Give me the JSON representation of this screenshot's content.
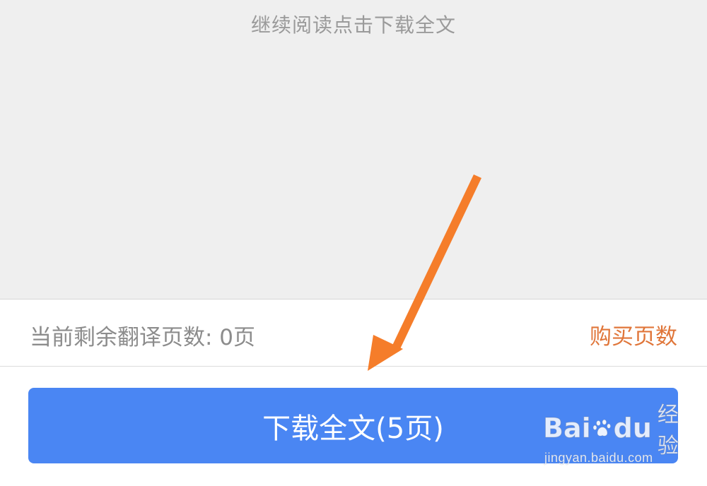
{
  "preview": {
    "continue_hint": "继续阅读点击下载全文"
  },
  "quota": {
    "remaining_label": "当前剩余翻译页数: 0页",
    "buy_link": "购买页数"
  },
  "download": {
    "button_label": "下载全文(5页)"
  },
  "annotation": {
    "arrow_color": "#f57d2a"
  },
  "watermark": {
    "logo_text_left": "Bai",
    "logo_text_right": "du",
    "logo_cn": "经验",
    "url": "jingyan.baidu.com"
  },
  "colors": {
    "accent": "#4a86f3",
    "link": "#e0763a",
    "muted_text": "#8c8c8c",
    "preview_bg": "#efefef"
  }
}
